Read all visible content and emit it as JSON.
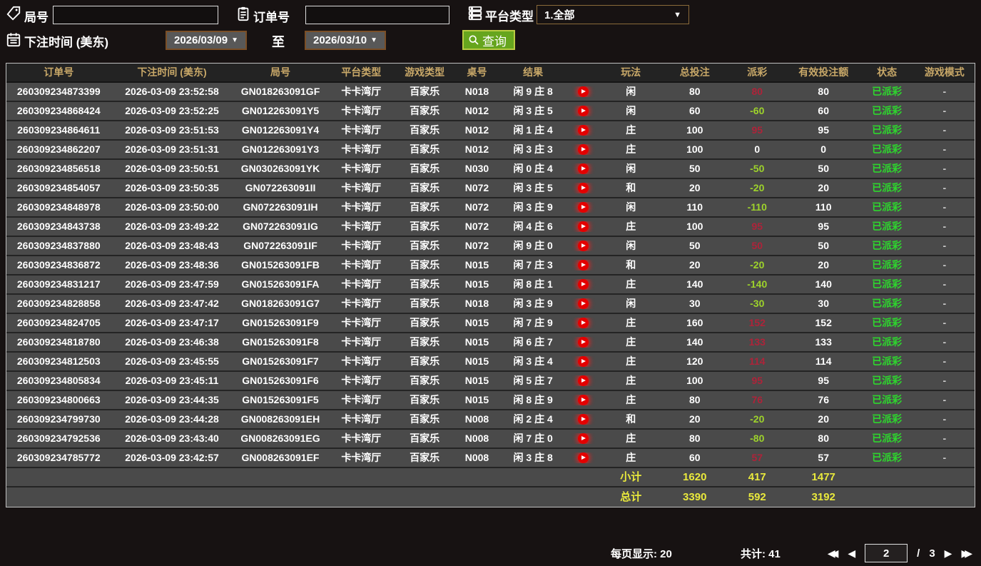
{
  "colors": {
    "gold": "#c8a868",
    "pos": "#ae2339",
    "neg": "#9ed32b",
    "status_green": "#2ed52e",
    "summary_yellow": "#e9e93c",
    "btn_green": "#66a51e"
  },
  "filters": {
    "round_label": "局号",
    "round_value": "",
    "order_label": "订单号",
    "order_value": "",
    "platform_label": "平台类型",
    "platform_value": "1.全部",
    "bet_time_label": "下注时间 (美东)",
    "date_from": "2026/03/09",
    "to_label": "至",
    "date_to": "2026/03/10",
    "query_label": "查询"
  },
  "table": {
    "headers": [
      "订单号",
      "下注时间 (美东)",
      "局号",
      "平台类型",
      "游戏类型",
      "桌号",
      "结果",
      "",
      "玩法",
      "总投注",
      "派彩",
      "有效投注额",
      "状态",
      "游戏模式"
    ],
    "rows": [
      {
        "order": "260309234873399",
        "time": "2026-03-09 23:52:58",
        "round": "GN018263091GF",
        "platform": "卡卡湾厅",
        "game": "百家乐",
        "table": "N018",
        "result": "闲 9 庄 8",
        "bet": "闲",
        "total": "80",
        "payout": "80",
        "valid": "80",
        "status": "已派彩",
        "mode": "-"
      },
      {
        "order": "260309234868424",
        "time": "2026-03-09 23:52:25",
        "round": "GN012263091Y5",
        "platform": "卡卡湾厅",
        "game": "百家乐",
        "table": "N012",
        "result": "闲 3 庄 5",
        "bet": "闲",
        "total": "60",
        "payout": "-60",
        "valid": "60",
        "status": "已派彩",
        "mode": "-"
      },
      {
        "order": "260309234864611",
        "time": "2026-03-09 23:51:53",
        "round": "GN012263091Y4",
        "platform": "卡卡湾厅",
        "game": "百家乐",
        "table": "N012",
        "result": "闲 1 庄 4",
        "bet": "庄",
        "total": "100",
        "payout": "95",
        "valid": "95",
        "status": "已派彩",
        "mode": "-"
      },
      {
        "order": "260309234862207",
        "time": "2026-03-09 23:51:31",
        "round": "GN012263091Y3",
        "platform": "卡卡湾厅",
        "game": "百家乐",
        "table": "N012",
        "result": "闲 3 庄 3",
        "bet": "庄",
        "total": "100",
        "payout": "0",
        "valid": "0",
        "status": "已派彩",
        "mode": "-"
      },
      {
        "order": "260309234856518",
        "time": "2026-03-09 23:50:51",
        "round": "GN030263091YK",
        "platform": "卡卡湾厅",
        "game": "百家乐",
        "table": "N030",
        "result": "闲 0 庄 4",
        "bet": "闲",
        "total": "50",
        "payout": "-50",
        "valid": "50",
        "status": "已派彩",
        "mode": "-"
      },
      {
        "order": "260309234854057",
        "time": "2026-03-09 23:50:35",
        "round": "GN072263091II",
        "platform": "卡卡湾厅",
        "game": "百家乐",
        "table": "N072",
        "result": "闲 3 庄 5",
        "bet": "和",
        "total": "20",
        "payout": "-20",
        "valid": "20",
        "status": "已派彩",
        "mode": "-"
      },
      {
        "order": "260309234848978",
        "time": "2026-03-09 23:50:00",
        "round": "GN072263091IH",
        "platform": "卡卡湾厅",
        "game": "百家乐",
        "table": "N072",
        "result": "闲 3 庄 9",
        "bet": "闲",
        "total": "110",
        "payout": "-110",
        "valid": "110",
        "status": "已派彩",
        "mode": "-"
      },
      {
        "order": "260309234843738",
        "time": "2026-03-09 23:49:22",
        "round": "GN072263091IG",
        "platform": "卡卡湾厅",
        "game": "百家乐",
        "table": "N072",
        "result": "闲 4 庄 6",
        "bet": "庄",
        "total": "100",
        "payout": "95",
        "valid": "95",
        "status": "已派彩",
        "mode": "-"
      },
      {
        "order": "260309234837880",
        "time": "2026-03-09 23:48:43",
        "round": "GN072263091IF",
        "platform": "卡卡湾厅",
        "game": "百家乐",
        "table": "N072",
        "result": "闲 9 庄 0",
        "bet": "闲",
        "total": "50",
        "payout": "50",
        "valid": "50",
        "status": "已派彩",
        "mode": "-"
      },
      {
        "order": "260309234836872",
        "time": "2026-03-09 23:48:36",
        "round": "GN015263091FB",
        "platform": "卡卡湾厅",
        "game": "百家乐",
        "table": "N015",
        "result": "闲 7 庄 3",
        "bet": "和",
        "total": "20",
        "payout": "-20",
        "valid": "20",
        "status": "已派彩",
        "mode": "-"
      },
      {
        "order": "260309234831217",
        "time": "2026-03-09 23:47:59",
        "round": "GN015263091FA",
        "platform": "卡卡湾厅",
        "game": "百家乐",
        "table": "N015",
        "result": "闲 8 庄 1",
        "bet": "庄",
        "total": "140",
        "payout": "-140",
        "valid": "140",
        "status": "已派彩",
        "mode": "-"
      },
      {
        "order": "260309234828858",
        "time": "2026-03-09 23:47:42",
        "round": "GN018263091G7",
        "platform": "卡卡湾厅",
        "game": "百家乐",
        "table": "N018",
        "result": "闲 3 庄 9",
        "bet": "闲",
        "total": "30",
        "payout": "-30",
        "valid": "30",
        "status": "已派彩",
        "mode": "-"
      },
      {
        "order": "260309234824705",
        "time": "2026-03-09 23:47:17",
        "round": "GN015263091F9",
        "platform": "卡卡湾厅",
        "game": "百家乐",
        "table": "N015",
        "result": "闲 7 庄 9",
        "bet": "庄",
        "total": "160",
        "payout": "152",
        "valid": "152",
        "status": "已派彩",
        "mode": "-"
      },
      {
        "order": "260309234818780",
        "time": "2026-03-09 23:46:38",
        "round": "GN015263091F8",
        "platform": "卡卡湾厅",
        "game": "百家乐",
        "table": "N015",
        "result": "闲 6 庄 7",
        "bet": "庄",
        "total": "140",
        "payout": "133",
        "valid": "133",
        "status": "已派彩",
        "mode": "-"
      },
      {
        "order": "260309234812503",
        "time": "2026-03-09 23:45:55",
        "round": "GN015263091F7",
        "platform": "卡卡湾厅",
        "game": "百家乐",
        "table": "N015",
        "result": "闲 3 庄 4",
        "bet": "庄",
        "total": "120",
        "payout": "114",
        "valid": "114",
        "status": "已派彩",
        "mode": "-"
      },
      {
        "order": "260309234805834",
        "time": "2026-03-09 23:45:11",
        "round": "GN015263091F6",
        "platform": "卡卡湾厅",
        "game": "百家乐",
        "table": "N015",
        "result": "闲 5 庄 7",
        "bet": "庄",
        "total": "100",
        "payout": "95",
        "valid": "95",
        "status": "已派彩",
        "mode": "-"
      },
      {
        "order": "260309234800663",
        "time": "2026-03-09 23:44:35",
        "round": "GN015263091F5",
        "platform": "卡卡湾厅",
        "game": "百家乐",
        "table": "N015",
        "result": "闲 8 庄 9",
        "bet": "庄",
        "total": "80",
        "payout": "76",
        "valid": "76",
        "status": "已派彩",
        "mode": "-"
      },
      {
        "order": "260309234799730",
        "time": "2026-03-09 23:44:28",
        "round": "GN008263091EH",
        "platform": "卡卡湾厅",
        "game": "百家乐",
        "table": "N008",
        "result": "闲 2 庄 4",
        "bet": "和",
        "total": "20",
        "payout": "-20",
        "valid": "20",
        "status": "已派彩",
        "mode": "-"
      },
      {
        "order": "260309234792536",
        "time": "2026-03-09 23:43:40",
        "round": "GN008263091EG",
        "platform": "卡卡湾厅",
        "game": "百家乐",
        "table": "N008",
        "result": "闲 7 庄 0",
        "bet": "庄",
        "total": "80",
        "payout": "-80",
        "valid": "80",
        "status": "已派彩",
        "mode": "-"
      },
      {
        "order": "260309234785772",
        "time": "2026-03-09 23:42:57",
        "round": "GN008263091EF",
        "platform": "卡卡湾厅",
        "game": "百家乐",
        "table": "N008",
        "result": "闲 3 庄 8",
        "bet": "庄",
        "total": "60",
        "payout": "57",
        "valid": "57",
        "status": "已派彩",
        "mode": "-"
      }
    ],
    "subtotal": {
      "label": "小计",
      "total": "1620",
      "payout": "417",
      "valid": "1477"
    },
    "grand_total": {
      "label": "总计",
      "total": "3390",
      "payout": "592",
      "valid": "3192"
    }
  },
  "footer": {
    "per_page_label": "每页显示:",
    "per_page_value": "20",
    "total_count_label": "共计:",
    "total_count_value": "41",
    "current_page": "2",
    "page_sep": "/",
    "total_pages": "3"
  }
}
